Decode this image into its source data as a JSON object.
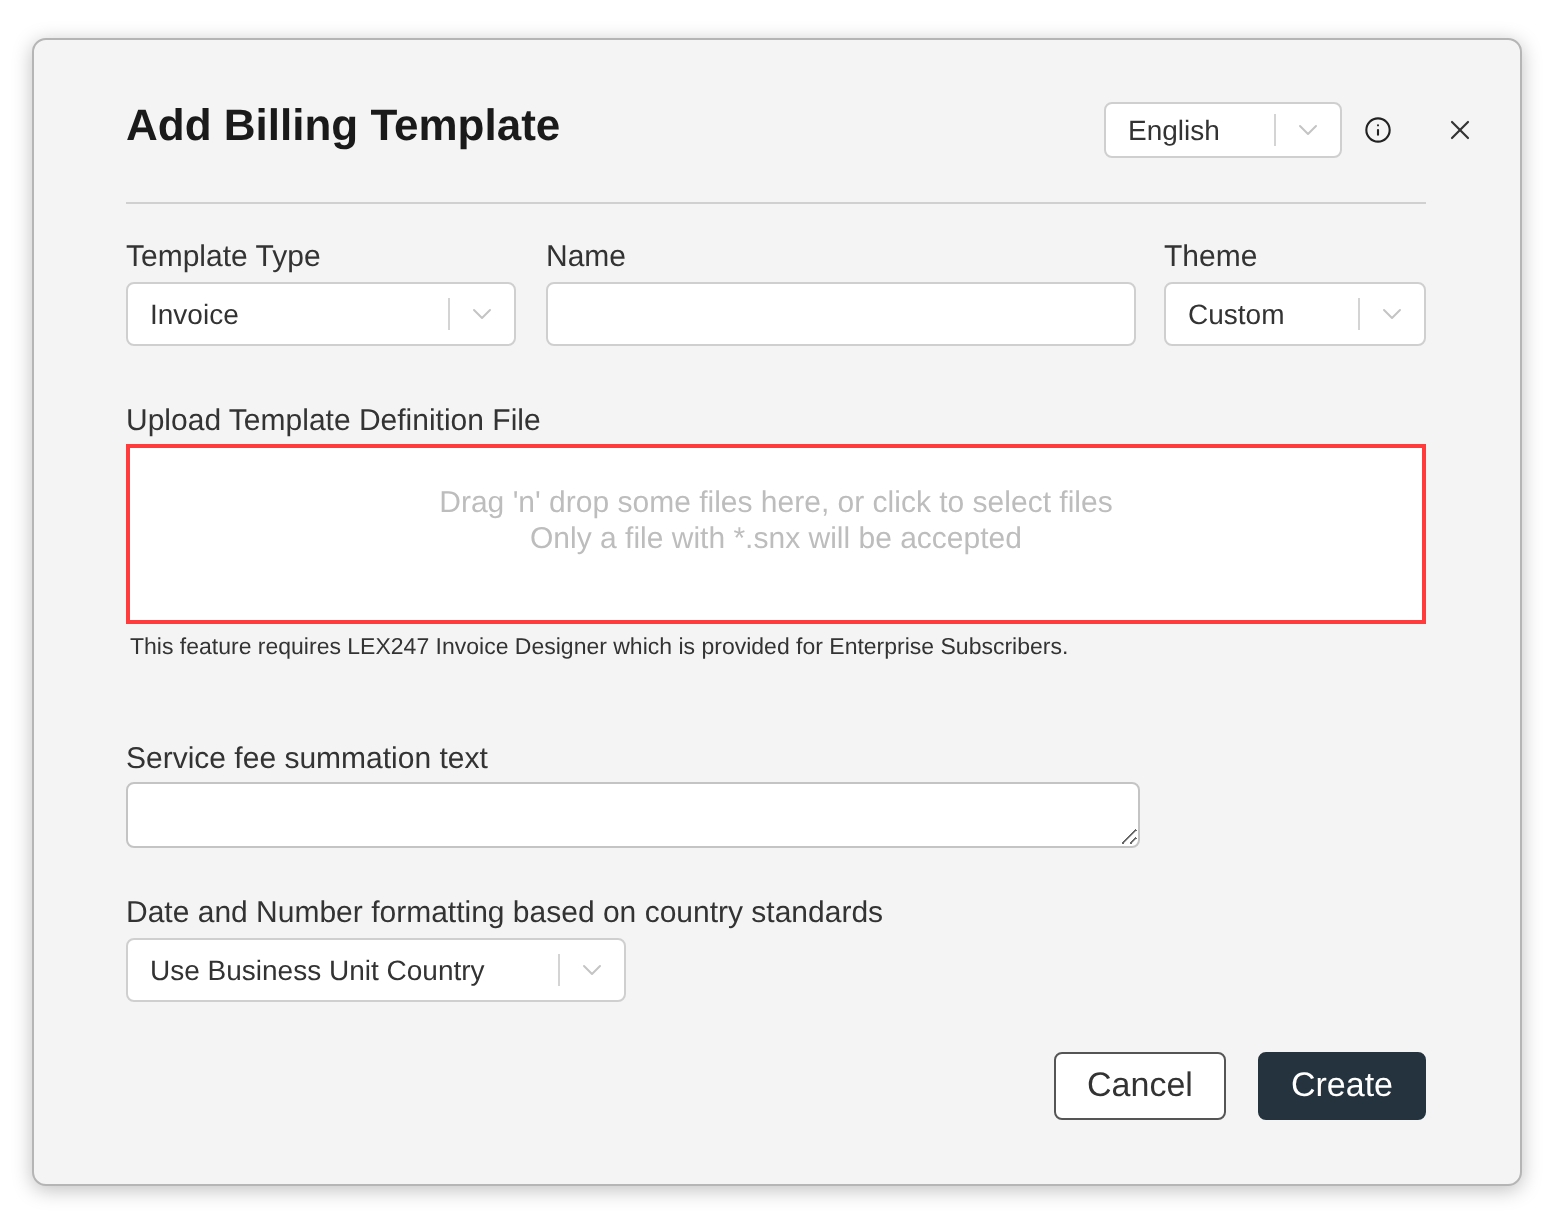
{
  "dialog": {
    "title": "Add Billing Template",
    "language": {
      "value": "English"
    }
  },
  "fields": [
    {
      "label": "Template Type",
      "kind": "select",
      "value": "Invoice"
    },
    {
      "label": "Name",
      "kind": "text"
    },
    {
      "label": "Theme",
      "kind": "select",
      "value": "Custom"
    }
  ],
  "upload": {
    "label": "Upload Template Definition File",
    "error": true,
    "prompt": [
      "Drag 'n' drop some files here, or click to select files",
      "Only a file with *.snx will be accepted"
    ],
    "note": "This feature requires LEX247 Invoice Designer which is provided for Enterprise Subscribers."
  },
  "service_fee": {
    "label": "Service fee summation text"
  },
  "formatting": {
    "label": "Date and Number formatting based on country standards",
    "value": "Use Business Unit Country"
  },
  "buttons": [
    {
      "label": "Cancel",
      "kind": "secondary"
    },
    {
      "label": "Create",
      "kind": "primary"
    }
  ]
}
